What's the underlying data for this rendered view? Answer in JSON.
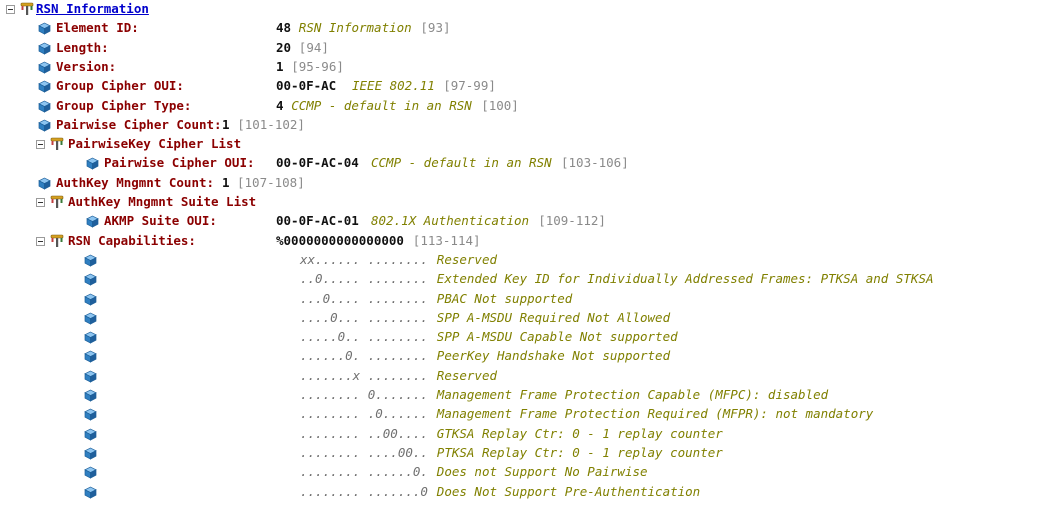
{
  "colors": {
    "label": "#8b0000",
    "description": "#808000",
    "range": "#8a8a8a",
    "link": "#0000cc",
    "cube": "#2f7fc1",
    "tree_node": "#d4a020"
  },
  "icons": {
    "expander": "minus-box-icon",
    "group": "tree-node-icon",
    "field": "cube-icon"
  },
  "root": {
    "label": "RSN Information"
  },
  "fields": [
    {
      "label": "Element ID:",
      "value": "48",
      "desc": "RSN Information",
      "range": "[93]"
    },
    {
      "label": "Length:",
      "value": "20",
      "desc": "",
      "range": "[94]"
    },
    {
      "label": "Version:",
      "value": "1",
      "desc": "",
      "range": "[95-96]"
    },
    {
      "label": "Group Cipher OUI:",
      "value": "00-0F-AC",
      "desc": "IEEE 802.11",
      "range": "[97-99]"
    },
    {
      "label": "Group Cipher Type:",
      "value": "4",
      "desc": "CCMP - default in an RSN",
      "range": "[100]"
    },
    {
      "label": "Pairwise Cipher Count:",
      "value": "1",
      "desc": "",
      "range": "[101-102]"
    }
  ],
  "pairwise_group": {
    "label": "PairwiseKey Cipher List",
    "item": {
      "label": "Pairwise Cipher OUI:",
      "value": "00-0F-AC-04",
      "desc": "CCMP - default in an RSN",
      "range": "[103-106]"
    }
  },
  "authkey_count": {
    "label": "AuthKey Mngmnt Count:",
    "value": "1",
    "range": "[107-108]"
  },
  "akm_group": {
    "label": "AuthKey Mngmnt Suite List",
    "item": {
      "label": "AKMP Suite OUI:",
      "value": "00-0F-AC-01",
      "desc": "802.1X Authentication",
      "range": "[109-112]"
    }
  },
  "capabilities": {
    "label": "RSN Capabilities:",
    "value": "%0000000000000000",
    "range": "[113-114]",
    "bits": [
      {
        "pattern": "xx...... ........",
        "desc": "Reserved"
      },
      {
        "pattern": "..0..... ........",
        "desc": "Extended Key ID for Individually Addressed Frames: PTKSA and STKSA"
      },
      {
        "pattern": "...0.... ........",
        "desc": "PBAC Not supported"
      },
      {
        "pattern": "....0... ........",
        "desc": "SPP A-MSDU Required Not Allowed"
      },
      {
        "pattern": ".....0.. ........",
        "desc": "SPP A-MSDU Capable Not supported"
      },
      {
        "pattern": "......0. ........",
        "desc": "PeerKey Handshake Not supported"
      },
      {
        "pattern": ".......x ........",
        "desc": "Reserved"
      },
      {
        "pattern": "........ 0.......",
        "desc": "Management Frame Protection Capable (MFPC): disabled"
      },
      {
        "pattern": "........ .0......",
        "desc": "Management Frame Protection Required (MFPR): not mandatory"
      },
      {
        "pattern": "........ ..00....",
        "desc": "GTKSA Replay Ctr: 0 - 1 replay counter"
      },
      {
        "pattern": "........ ....00..",
        "desc": "PTKSA Replay Ctr: 0 - 1 replay counter"
      },
      {
        "pattern": "........ ......0.",
        "desc": "Does not Support No Pairwise"
      },
      {
        "pattern": "........ .......0",
        "desc": "Does Not Support Pre-Authentication"
      }
    ]
  }
}
